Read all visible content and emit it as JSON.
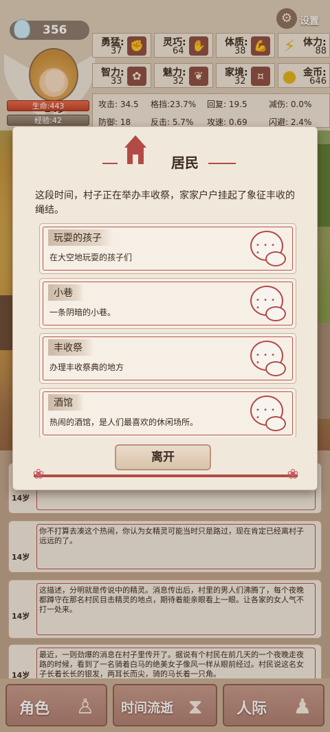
{
  "settings_label": "设置",
  "player": {
    "spirit_count": "356",
    "age": "14岁",
    "hp": "生命:443",
    "xp": "经验:42"
  },
  "stats": [
    {
      "name": "勇猛:",
      "value": "37",
      "icon": "fist-icon",
      "glyph": "✊"
    },
    {
      "name": "灵巧:",
      "value": "64",
      "icon": "hand-icon",
      "glyph": "✋"
    },
    {
      "name": "体质:",
      "value": "38",
      "icon": "arm-icon",
      "glyph": "💪"
    },
    {
      "name": "智力:",
      "value": "33",
      "icon": "brain-icon",
      "glyph": "✿"
    },
    {
      "name": "魅力:",
      "value": "32",
      "icon": "heart-icon",
      "glyph": "❦"
    },
    {
      "name": "家境:",
      "value": "32",
      "icon": "money-icon",
      "glyph": "¤"
    }
  ],
  "resources": [
    {
      "name": "体力:",
      "value": "88",
      "icon": "lightning-icon",
      "glyph": "⚡"
    },
    {
      "name": "金币:",
      "value": "646",
      "icon": "coin-icon",
      "glyph": "●"
    }
  ],
  "combat": {
    "row1": [
      {
        "label": "攻击: 34.5"
      },
      {
        "label": "格挡:23.7%"
      },
      {
        "label": "回复:   19.5"
      },
      {
        "label": "减伤: 0.0%"
      }
    ],
    "row2": [
      {
        "label": "防御:   18"
      },
      {
        "label": "反击: 5.7%"
      },
      {
        "label": "攻速: 0.69"
      },
      {
        "label": "闪避: 2.4%"
      }
    ]
  },
  "dialog": {
    "title": "居民",
    "description": "这段时间，村子正在举办丰收祭，家家户户挂起了象征丰收的绳结。",
    "options": [
      {
        "title": "玩耍的孩子",
        "desc": "在大空地玩耍的孩子们"
      },
      {
        "title": "小巷",
        "desc": "一条阴暗的小巷。"
      },
      {
        "title": "丰收祭",
        "desc": "办理丰收祭典的地方"
      },
      {
        "title": "酒馆",
        "desc": "热闹的酒馆，是人们最喜欢的休闲场所。"
      }
    ],
    "leave_label": "离开"
  },
  "log": [
    {
      "age": "14岁",
      "text": ""
    },
    {
      "age": "14岁",
      "text": "你不打算去凑这个热闹，你认为女精灵可能当时只是路过，现在肯定已经离村子远远的了。"
    },
    {
      "age": "14岁",
      "text": "这描述，分明就是传说中的精灵。消息传出后，村里的男人们沸腾了，每个夜晚都蹲守在那名村民目击精灵的地点，期待着能亲眼看上一眼。让各家的女人气不打一处来。"
    },
    {
      "age": "14岁",
      "text": "最近，一则劲爆的消息在村子里传开了。据说有个村民在前几天的一个夜晚走夜路的时候，看到了一名骑着白马的绝美女子像风一样从眼前经过。村民说这名女子长着长长的银发，两耳长而尖，骑的马长着一只角。"
    }
  ],
  "nav": [
    {
      "label": "角色",
      "icon": "character-icon"
    },
    {
      "label": "时间流逝",
      "icon": "hourglass-icon"
    },
    {
      "label": "人际",
      "icon": "people-icon"
    }
  ]
}
